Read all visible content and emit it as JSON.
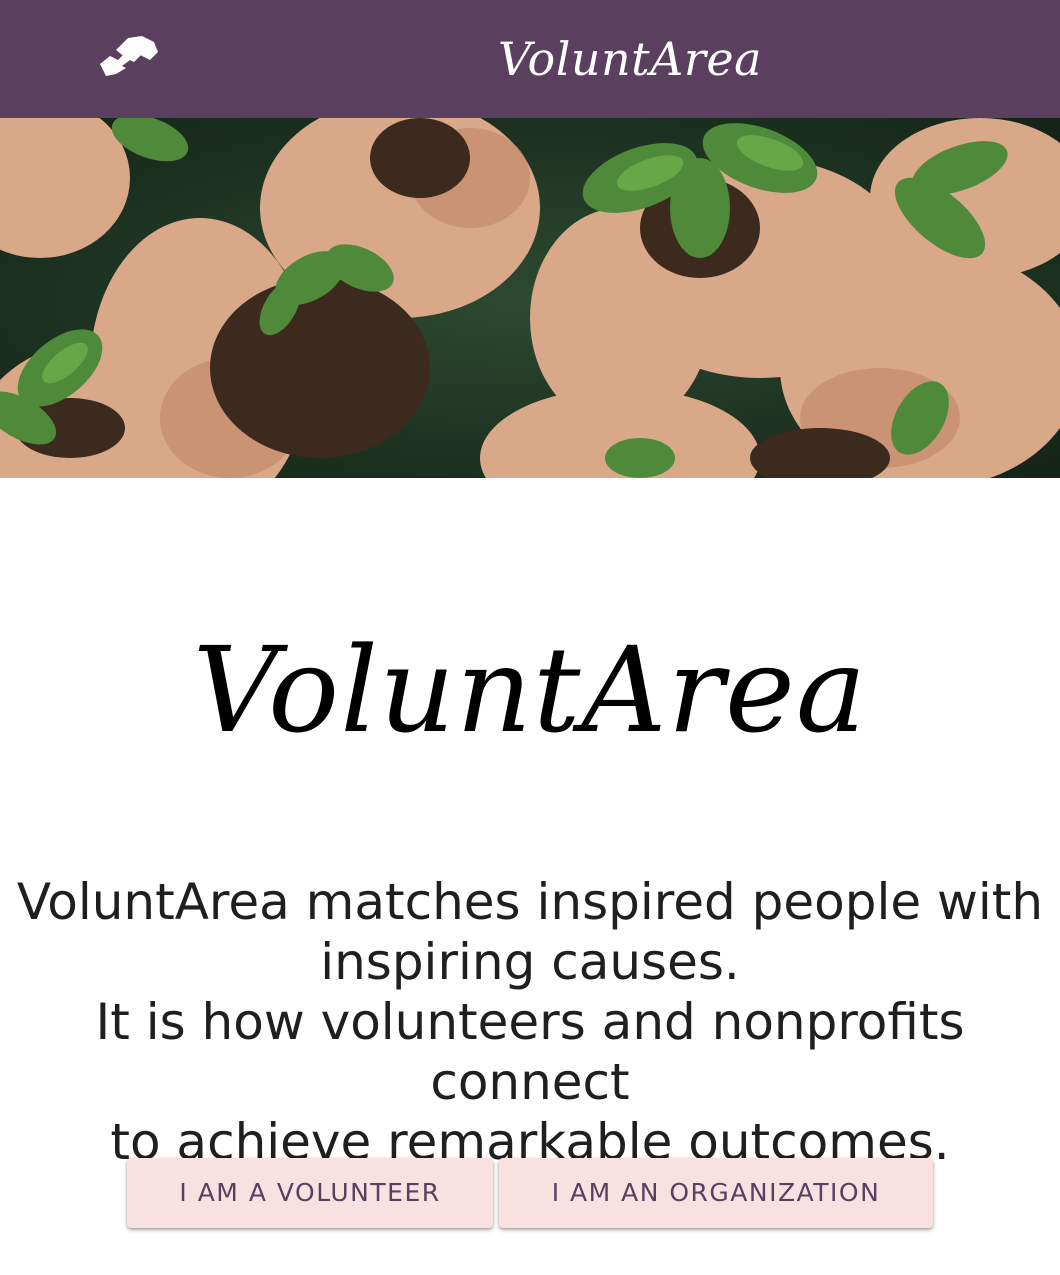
{
  "header": {
    "title": "VoluntArea",
    "logo_icon": "handshake-icon",
    "background_color": "#5a3f5f"
  },
  "hero": {
    "image_description_icon": "hands-holding-seedlings-image"
  },
  "main": {
    "brand_title": "VoluntArea",
    "tagline_line1": "VoluntArea matches inspired people with",
    "tagline_line2": "inspiring causes.",
    "tagline_line3": "It is how volunteers and nonprofits connect",
    "tagline_line4": "to achieve remarkable outcomes."
  },
  "actions": {
    "volunteer_label": "I AM A VOLUNTEER",
    "organization_label": "I AM AN ORGANIZATION",
    "button_color": "#fae1e1",
    "button_text_color": "#5a3f5f"
  }
}
